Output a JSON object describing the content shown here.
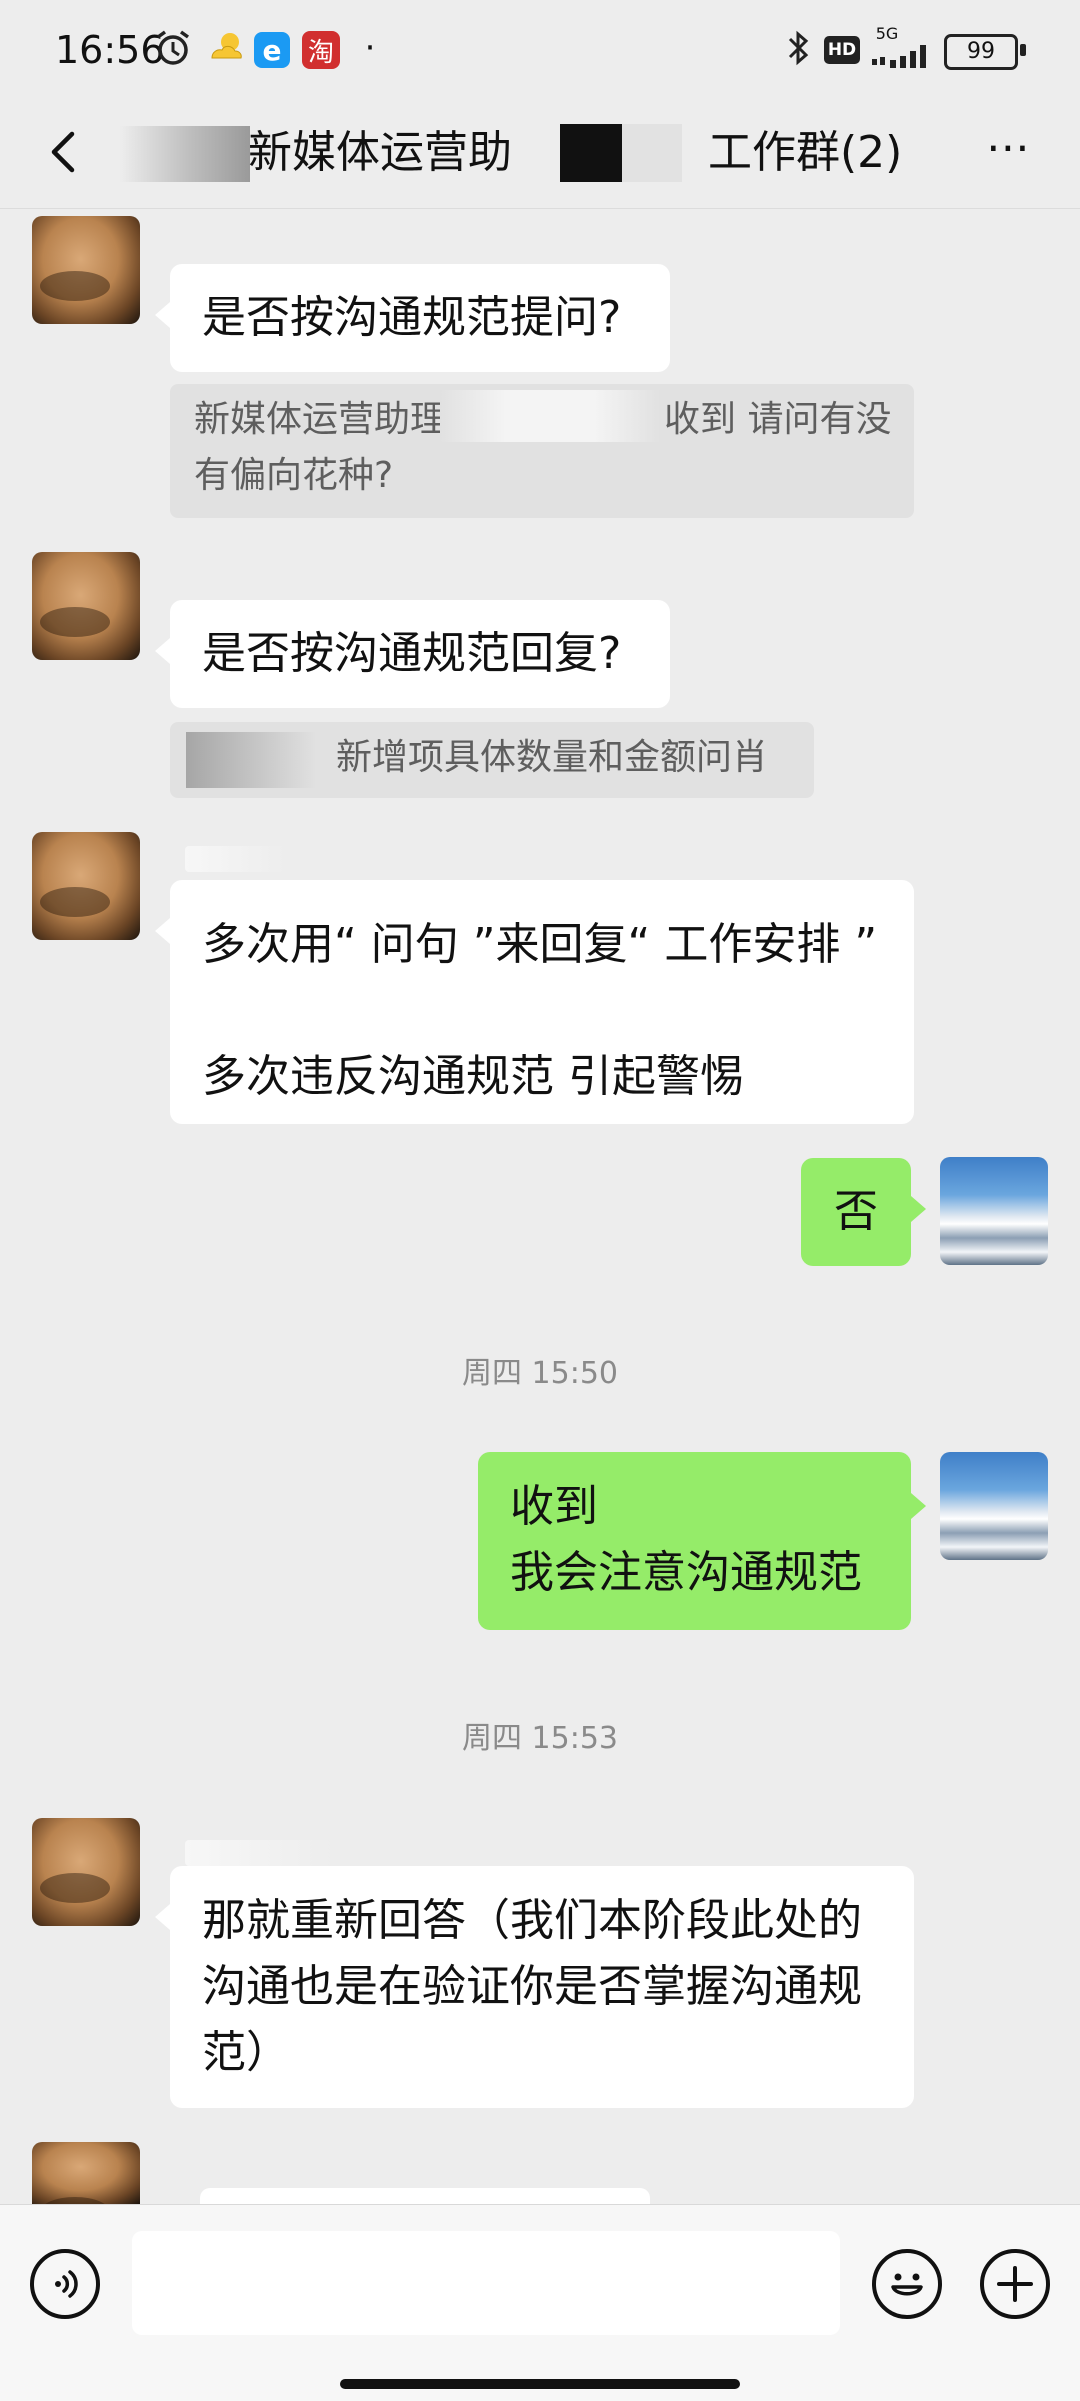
{
  "status_bar": {
    "time": "16:56",
    "battery": "99",
    "network": "5G",
    "hd": "HD",
    "app_icon_e": "e",
    "app_icon_tao": "淘",
    "dot": "·"
  },
  "nav": {
    "title_name": "新媒体运营助",
    "title_group": "工作群(2)",
    "more": "⋯"
  },
  "messages": [
    {
      "side": "left",
      "text": "是否按沟通规范提问?"
    },
    {
      "quote_line1_a": "新媒体运营助理",
      "quote_line1_b": "收到 请问有没",
      "quote_line2": "有偏向花种?"
    },
    {
      "side": "left",
      "text": "是否按沟通规范回复?"
    },
    {
      "quote_text": "新增项具体数量和金额问肖"
    },
    {
      "side": "left",
      "line1": "多次用“ 问句 ”来回复“ 工作安排 ”",
      "line2": "多次违反沟通规范 引起警惕"
    },
    {
      "side": "right",
      "text": "否"
    },
    {
      "side": "right",
      "line1": "收到",
      "line2": "我会注意沟通规范"
    },
    {
      "side": "left",
      "line1": "那就重新回答（我们本阶段此处的",
      "line2": "沟通也是在验证你是否掌握沟通规",
      "line3": "范）"
    }
  ],
  "timestamps": [
    "周四 15:50",
    "周四 15:53"
  ],
  "colors": {
    "background": "#ededed",
    "bubble_self": "#95ec69",
    "bubble_other": "#ffffff",
    "quote_bg": "#e1e1e1"
  },
  "icons": {
    "back": "chevron-left-icon",
    "more": "more-icon",
    "voice": "voice-icon",
    "emoji": "emoji-icon",
    "plus": "plus-icon"
  }
}
